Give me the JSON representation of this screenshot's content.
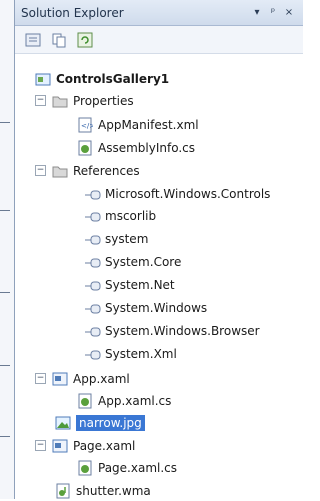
{
  "panel": {
    "title": "Solution Explorer",
    "controls": {
      "dropdown": "▾",
      "pin": "ᵖ",
      "close": "×"
    }
  },
  "toolbar": {
    "buttons": [
      {
        "icon": "properties-icon"
      },
      {
        "icon": "show-all-files-icon"
      },
      {
        "icon": "refresh-icon"
      }
    ]
  },
  "tree": {
    "project": "ControlsGallery1",
    "properties": "Properties",
    "appmanifest": "AppManifest.xml",
    "assemblyinfo": "AssemblyInfo.cs",
    "references": "References",
    "ref_items": [
      "Microsoft.Windows.Controls",
      "mscorlib",
      "system",
      "System.Core",
      "System.Net",
      "System.Windows",
      "System.Windows.Browser",
      "System.Xml"
    ],
    "app_xaml": "App.xaml",
    "app_xaml_cs": "App.xaml.cs",
    "narrow": "narrow.jpg",
    "page_xaml": "Page.xaml",
    "page_xaml_cs": "Page.xaml.cs",
    "shutter": "shutter.wma"
  },
  "colors": {
    "selection": "#3a77d4",
    "title_gradient_top": "#e3ebf6",
    "title_gradient_bottom": "#cfdbec"
  }
}
